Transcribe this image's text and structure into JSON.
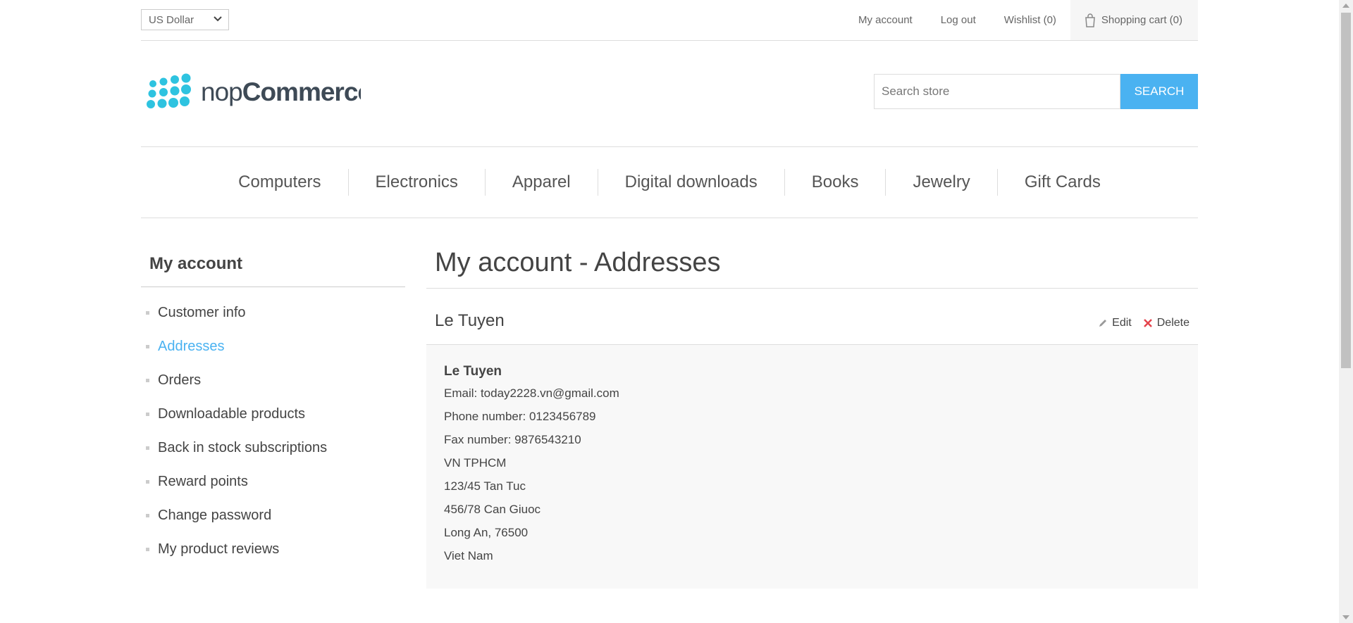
{
  "header": {
    "currency": "US Dollar",
    "links": [
      "My account",
      "Log out",
      "Wishlist (0)"
    ],
    "cart": "Shopping cart (0)"
  },
  "logo": {
    "prefix": "nop",
    "brand": "Commerce"
  },
  "search": {
    "placeholder": "Search store",
    "button": "SEARCH"
  },
  "menu": [
    "Computers",
    "Electronics",
    "Apparel",
    "Digital downloads",
    "Books",
    "Jewelry",
    "Gift Cards"
  ],
  "sidebar": {
    "title": "My account",
    "items": [
      {
        "label": "Customer info"
      },
      {
        "label": "Addresses"
      },
      {
        "label": "Orders"
      },
      {
        "label": "Downloadable products"
      },
      {
        "label": "Back in stock subscriptions"
      },
      {
        "label": "Reward points"
      },
      {
        "label": "Change password"
      },
      {
        "label": "My product reviews"
      }
    ],
    "active": "Addresses"
  },
  "main": {
    "title": "My account - Addresses",
    "address": {
      "title": "Le Tuyen",
      "edit": "Edit",
      "delete": "Delete",
      "name": "Le Tuyen",
      "email": "Email: today2228.vn@gmail.com",
      "phone": "Phone number: 0123456789",
      "fax": "Fax number: 9876543210",
      "company": "VN TPHCM",
      "address1": "123/45 Tan Tuc",
      "address2": "456/78 Can Giuoc",
      "city": "Long An, 76500",
      "country": "Viet Nam"
    }
  },
  "colors": {
    "accent": "#4ab2f1",
    "logo": "#2ec3e0",
    "delete": "#e4444c"
  }
}
